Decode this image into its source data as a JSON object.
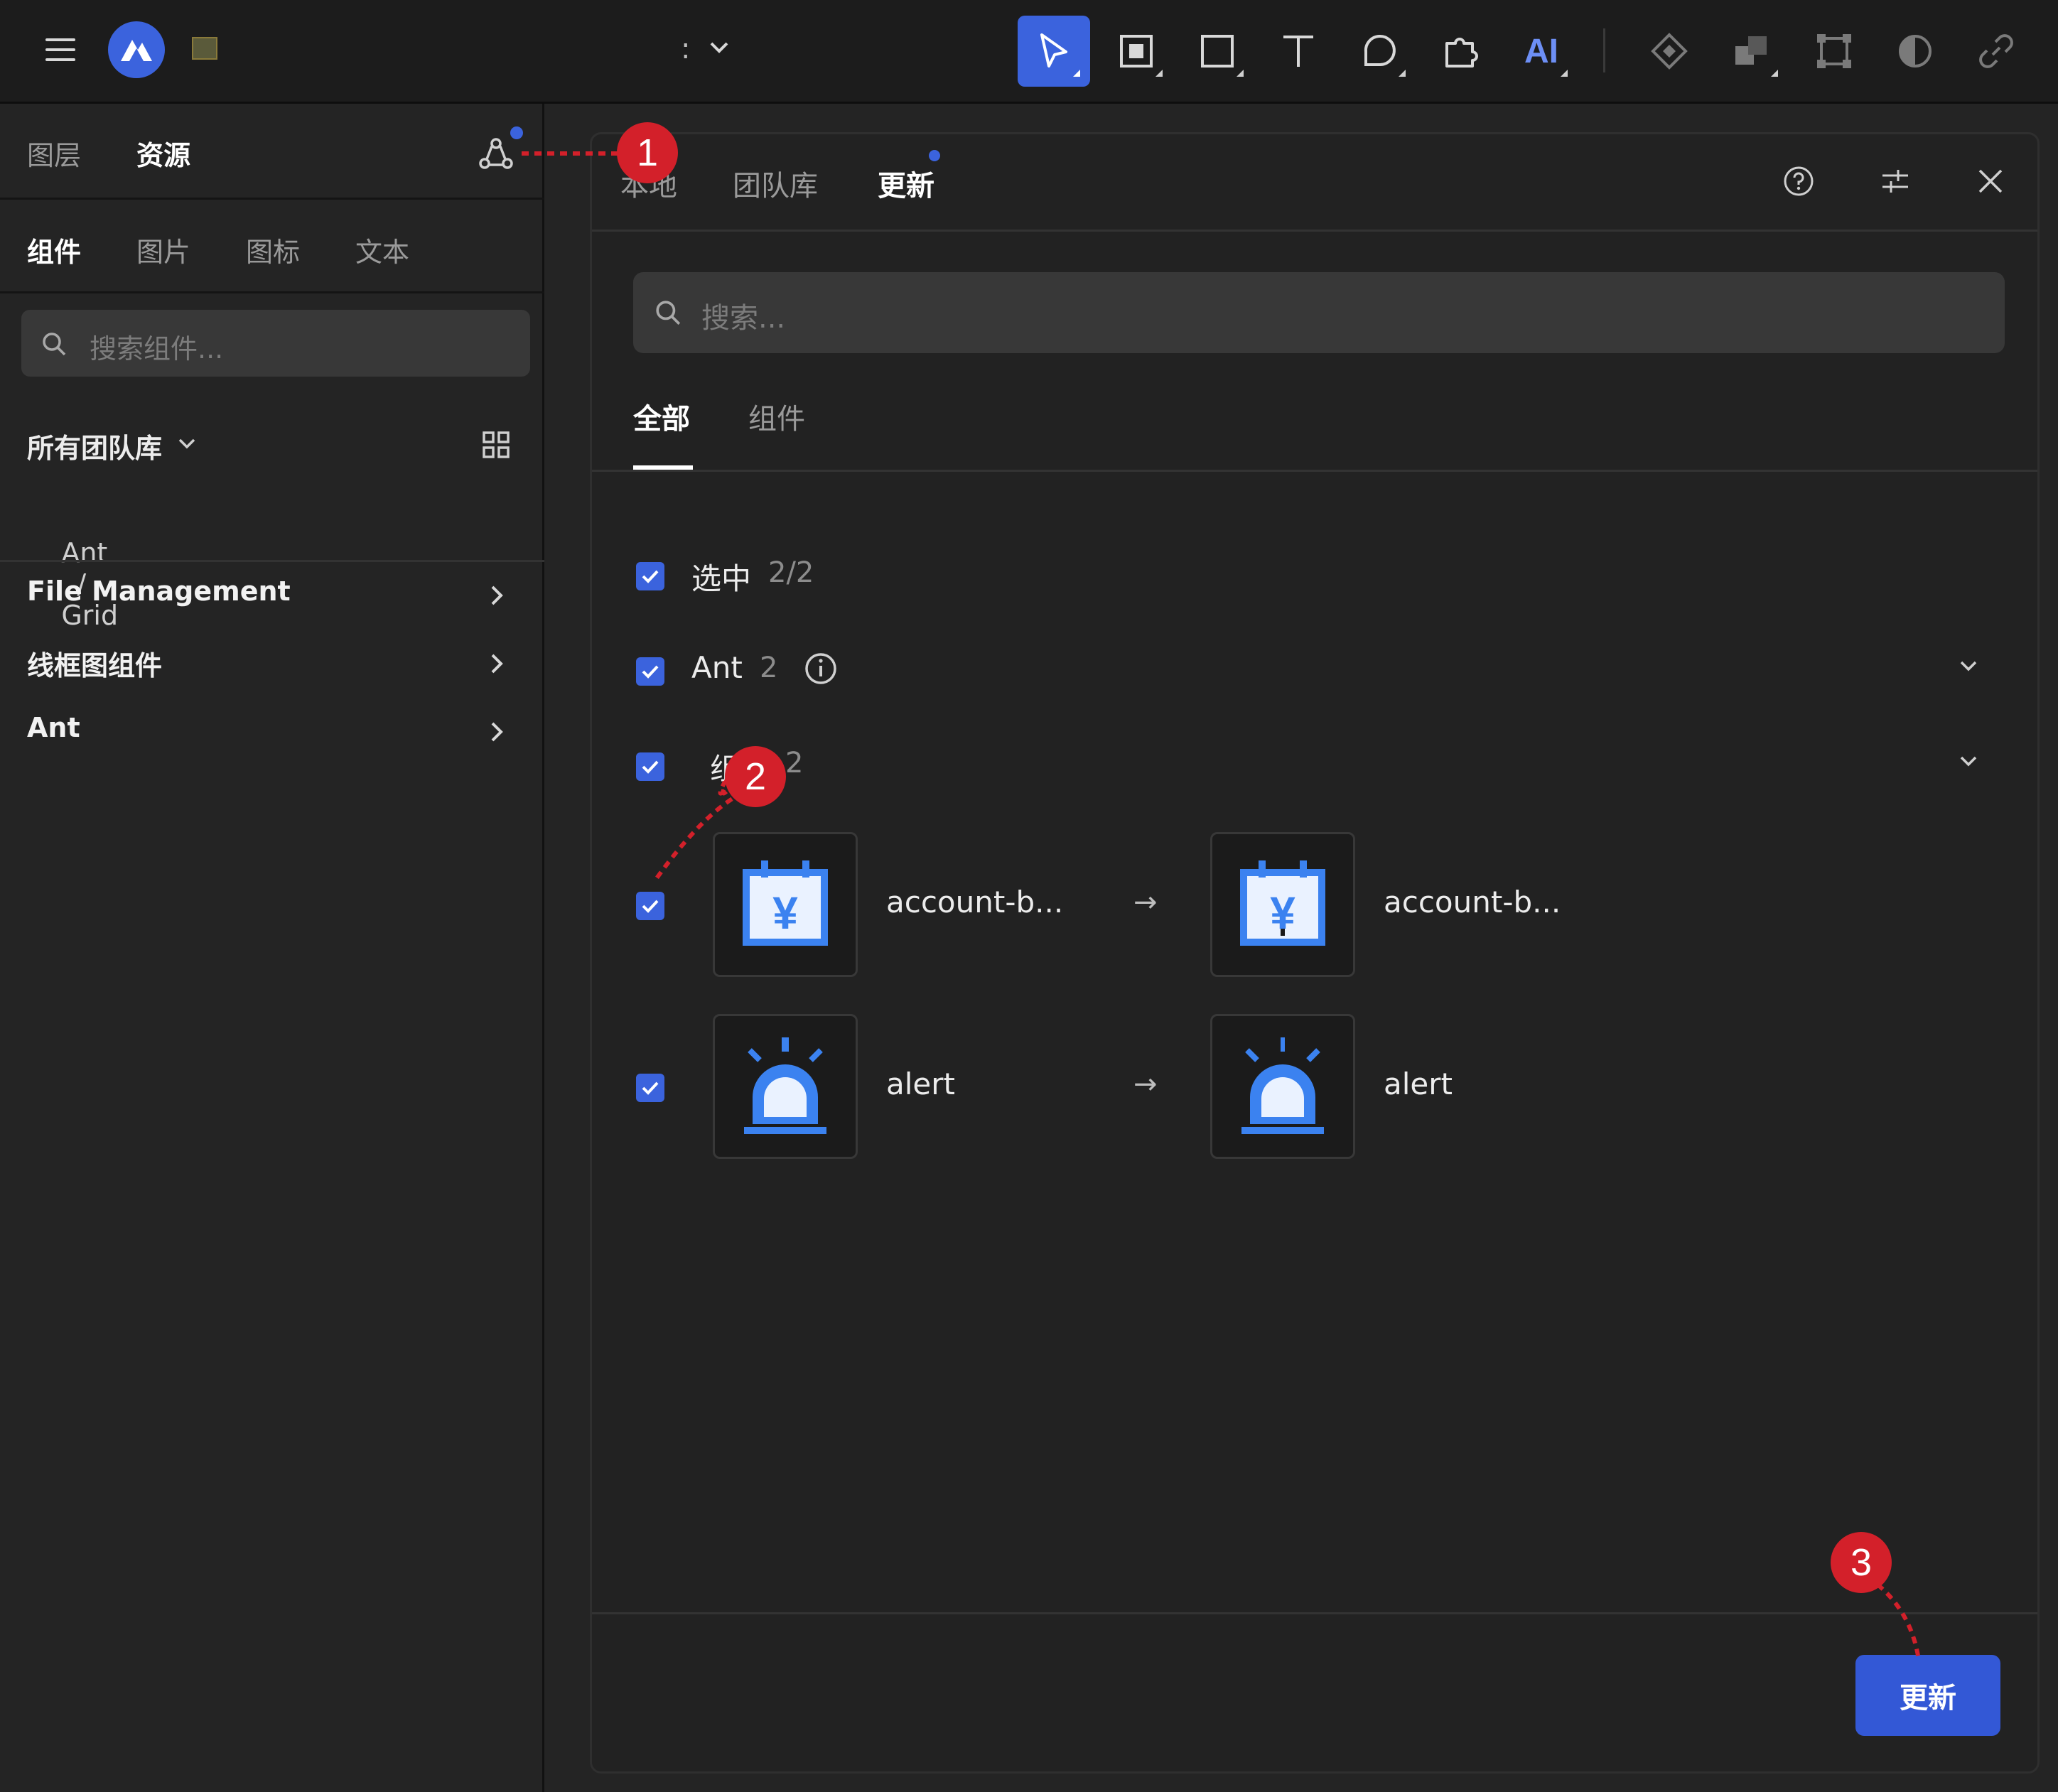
{
  "topbar": {
    "title_fragment": ":",
    "ai_label": "AI"
  },
  "left_panel": {
    "tabs": [
      "图层",
      "资源"
    ],
    "sub_tabs": [
      "组件",
      "图片",
      "图标",
      "文本"
    ],
    "search_placeholder": "搜索组件...",
    "library_selector": "所有团队库",
    "breadcrumb": {
      "root": "Ant",
      "separator": "/",
      "current": "Grid"
    },
    "libraries": [
      "File Management",
      "线框图组件",
      "Ant"
    ]
  },
  "modal": {
    "tabs": [
      "本地",
      "团队库",
      "更新"
    ],
    "search_placeholder": "搜索...",
    "sub_tabs": [
      "全部",
      "组件"
    ],
    "select_label": "选中",
    "select_count": "2/2",
    "group_name": "Ant",
    "group_count": "2",
    "category_name": "组件",
    "category_count": "2",
    "items": [
      {
        "old_name": "account-b...",
        "arrow": "→",
        "new_name": "account-b...",
        "icon": "account-book-icon"
      },
      {
        "old_name": "alert",
        "arrow": "→",
        "new_name": "alert",
        "icon": "alert-icon"
      }
    ],
    "update_button": "更新"
  },
  "annotations": [
    "1",
    "2",
    "3"
  ],
  "colors": {
    "accent": "#3b63dd",
    "marker": "#d3202a",
    "background": "#242424",
    "icon_blue": "#3b82f0"
  }
}
